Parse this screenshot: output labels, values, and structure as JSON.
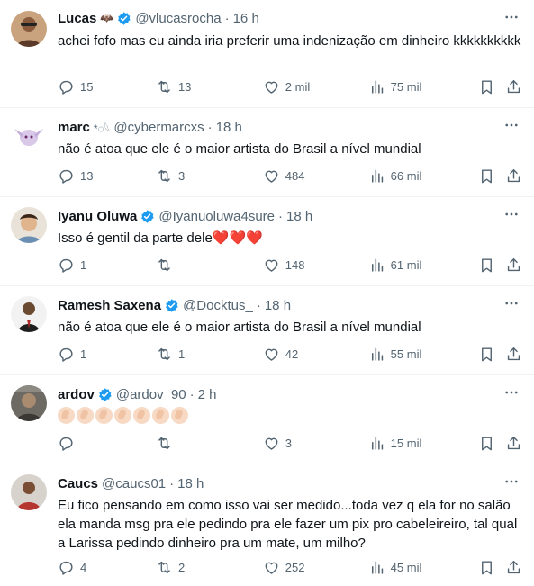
{
  "tweets": [
    {
      "name": "Lucas",
      "name_emoji": "🦇",
      "handle": "@vlucasrocha",
      "time": "16 h",
      "verified": true,
      "text": "achei fofo mas eu ainda iria preferir uma indenização em dinheiro kkkkkkkkkk",
      "replies": "15",
      "retweets": "13",
      "likes": "2 mil",
      "views": "75 mil",
      "avatar_color": "#c9a27e"
    },
    {
      "name": "marc",
      "name_emoji": "*◌⁠⁠𓆩",
      "handle": "@cybermarcxs",
      "time": "18 h",
      "verified": false,
      "text": "não é atoa que ele é o maior artista do Brasil a nível mundial",
      "replies": "13",
      "retweets": "3",
      "likes": "484",
      "views": "66 mil",
      "avatar_color": "#d9c8e8"
    },
    {
      "name": "Iyanu Oluwa",
      "handle": "@Iyanuoluwa4sure",
      "time": "18 h",
      "verified": true,
      "text": "Isso é gentil da parte dele",
      "text_suffix": "❤️❤️❤️",
      "replies": "1",
      "retweets": "",
      "likes": "148",
      "views": "61 mil",
      "avatar_color": "#e9c9a8"
    },
    {
      "name": "Ramesh Saxena",
      "handle": "@Docktus_",
      "time": "18 h",
      "verified": true,
      "text": "não é atoa que ele é o maior artista do Brasil a nível mundial",
      "replies": "1",
      "retweets": "1",
      "likes": "42",
      "views": "55 mil",
      "avatar_color": "#3a3a3a"
    },
    {
      "name": "ardov",
      "handle": "@ardov_90",
      "time": "2 h",
      "verified": true,
      "text": "",
      "claps": 7,
      "replies": "",
      "retweets": "",
      "likes": "3",
      "views": "15 mil",
      "avatar_color": "#6d6a63"
    },
    {
      "name": "Caucs",
      "handle": "@caucs01",
      "time": "18 h",
      "verified": false,
      "text": "Eu fico pensando em como isso vai ser medido...toda vez q ela for no salão ela manda msg pra ele pedindo pra ele fazer um pix pro cabeleireiro, tal qual a Larissa pedindo dinheiro pra um mate, um milho?",
      "replies": "4",
      "retweets": "2",
      "likes": "252",
      "views": "45 mil",
      "avatar_color": "#b5352f"
    }
  ],
  "colors": {
    "verified": "#1d9bf0",
    "secondary_text": "#536471",
    "divider": "#eff3f4"
  },
  "icons": [
    "reply-icon",
    "retweet-icon",
    "like-icon",
    "views-icon",
    "bookmark-icon",
    "share-icon",
    "more-icon",
    "verified-icon"
  ]
}
